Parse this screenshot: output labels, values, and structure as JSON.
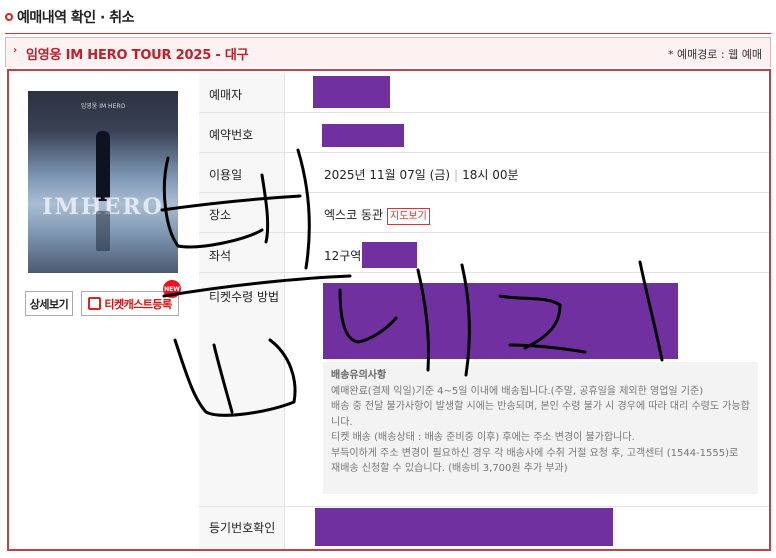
{
  "page": {
    "title": "예매내역 확인 · 취소"
  },
  "show": {
    "title": "임영웅 IM HERO TOUR 2025 - 대구",
    "route": "* 예매경로 : 웹 예매"
  },
  "poster": {
    "title_text": "IMHERO",
    "small_text": "임영웅 IM HERO"
  },
  "buttons": {
    "detail": "상세보기",
    "ticketcast": "티켓캐스트등록",
    "new_badge": "NEW"
  },
  "rows": {
    "booker_label": "예매자",
    "booking_no_label": "예약번호",
    "date_label": "이용일",
    "date_value": "2025년 11월 07일 (금)",
    "time_value": "18시 00분",
    "venue_label": "장소",
    "venue_value": "엑스코 동관",
    "map_button": "지도보기",
    "seat_label": "좌석",
    "seat_value": "12구역",
    "receive_label": "티켓수령 방법",
    "register_label": "등기번호확인"
  },
  "notice": {
    "title": "배송유의사항",
    "line1": "예매완료(결제 익일)기준 4~5일 이내에 배송됩니다.(주말, 공휴일을 제외한 영업일 기준)",
    "line2": "배송 중 전달 불가사항이 발생할 시에는 반송되며, 본인 수령 불가 시 경우에 따라 대리 수령도 가능합니다.",
    "line3": "티켓 배송 (배송상태 : 배송 준비중 이후) 후에는 주소 변경이 불가합니다.",
    "line4": "부득이하게 주소 변경이 필요하신 경우 각 배송사에 수취 거절 요청 후, 고객센터 (1544-1555)로 재배송 신청할 수 있습니다. (배송비 3,700원 추가 부과)"
  },
  "colors": {
    "accent": "#c0202a",
    "redaction": "#7030a0",
    "border": "#c2424a"
  }
}
